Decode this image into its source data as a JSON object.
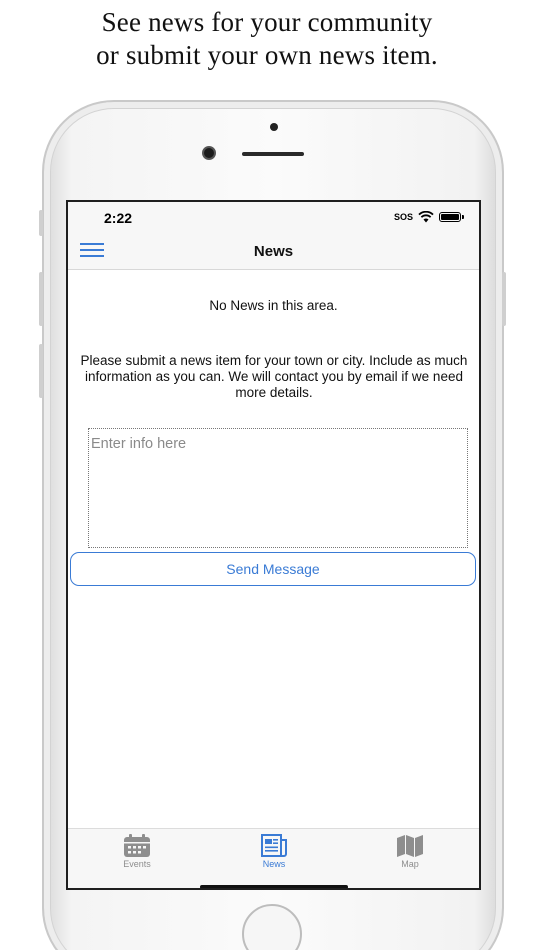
{
  "caption": {
    "line1": "See news for your community",
    "line2": "or submit your own news item."
  },
  "status_bar": {
    "time": "2:22",
    "sos": "SOS"
  },
  "nav": {
    "title": "News"
  },
  "content": {
    "empty_message": "No News in this area.",
    "instructions": "Please submit a news item for your town or city. Include as much information as you can. We will contact you by email if we need more details.",
    "info_placeholder": "Enter info here",
    "info_value": "",
    "send_label": "Send Message"
  },
  "tabs": [
    {
      "label": "Events",
      "icon": "calendar-icon",
      "active": false
    },
    {
      "label": "News",
      "icon": "newspaper-icon",
      "active": true
    },
    {
      "label": "Map",
      "icon": "map-icon",
      "active": false
    }
  ],
  "colors": {
    "accent": "#3a7bd5",
    "inactive_tab": "#8e8e8e"
  }
}
